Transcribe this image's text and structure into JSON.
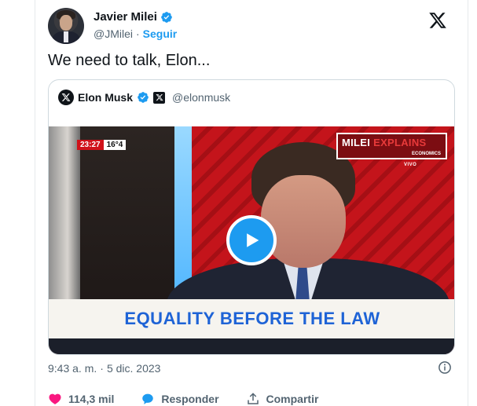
{
  "author": {
    "name": "Javier Milei",
    "handle": "@JMilei",
    "separator": "·",
    "follow_label": "Seguir"
  },
  "tweet": {
    "text": "We need to talk, Elon..."
  },
  "quoted": {
    "name": "Elon Musk",
    "handle": "@elonmusk"
  },
  "video": {
    "clock": "23:27",
    "temp": "16°4",
    "logo_main": "MILEI",
    "logo_accent": "EXPLAINS",
    "logo_sub": "ECONOMICS",
    "live": "VIVO",
    "banner": "EQUALITY BEFORE THE LAW"
  },
  "meta": {
    "time": "9:43 a. m.",
    "separator": "·",
    "date": "5 dic. 2023"
  },
  "actions": {
    "likes": "114,3 mil",
    "reply_label": "Responder",
    "share_label": "Compartir"
  },
  "colors": {
    "accent": "#1d9bf0",
    "like": "#f91880",
    "muted": "#536471"
  }
}
